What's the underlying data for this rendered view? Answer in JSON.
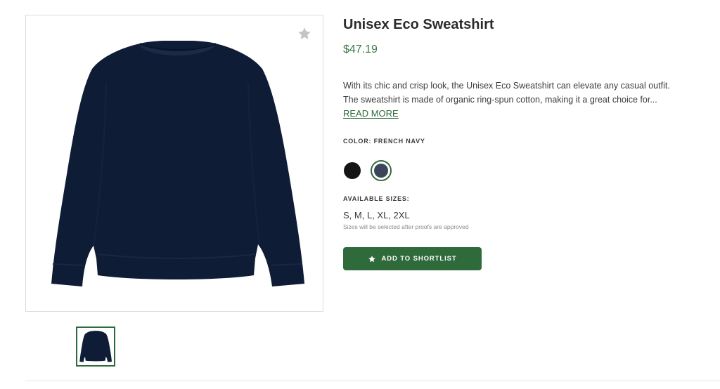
{
  "product": {
    "title": "Unisex Eco Sweatshirt",
    "price": "$47.19",
    "description_line1": "With its chic and crisp look, the Unisex Eco Sweatshirt can elevate any casual outfit.",
    "description_line2": "The sweatshirt is made of organic ring-spun cotton, making it a great choice for...",
    "read_more_label": "READ MORE"
  },
  "color": {
    "label": "COLOR: FRENCH NAVY",
    "swatches": [
      {
        "name": "black",
        "hex": "#141414",
        "selected": false
      },
      {
        "name": "french-navy",
        "hex": "#3c465a",
        "selected": true
      }
    ]
  },
  "sizes": {
    "label": "AVAILABLE SIZES:",
    "value": "S, M, L, XL, 2XL",
    "note": "Sizes will be selected after proofs are approved"
  },
  "actions": {
    "shortlist_label": "ADD TO SHORTLIST"
  },
  "icons": {
    "favorite": "star-icon",
    "shortlist": "star-icon"
  },
  "colors": {
    "accent": "#2f6a3b",
    "price": "#3c7a48",
    "garment": "#0f1c36"
  }
}
